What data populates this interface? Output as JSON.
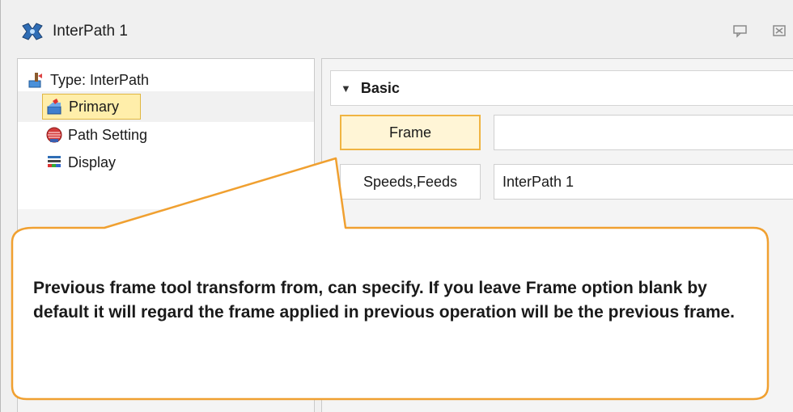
{
  "window": {
    "title": "InterPath 1"
  },
  "tree": {
    "root_label": "Type: InterPath",
    "items": [
      {
        "label": "Primary",
        "selected": true
      },
      {
        "label": "Path Setting",
        "selected": false
      },
      {
        "label": "Display",
        "selected": false
      }
    ]
  },
  "properties": {
    "section_title": "Basic",
    "rows": [
      {
        "label": "Frame",
        "value": ""
      },
      {
        "label": "Speeds,Feeds",
        "value": "InterPath 1"
      }
    ]
  },
  "callout": {
    "text": "Previous frame tool transform from, can specify. If you leave Frame option blank by default it will regard  the frame applied in previous operation will be the previous frame."
  },
  "colors": {
    "selection_fill": "#ffeeaa",
    "selection_border": "#e0b742",
    "callout_border": "#f0a030"
  }
}
